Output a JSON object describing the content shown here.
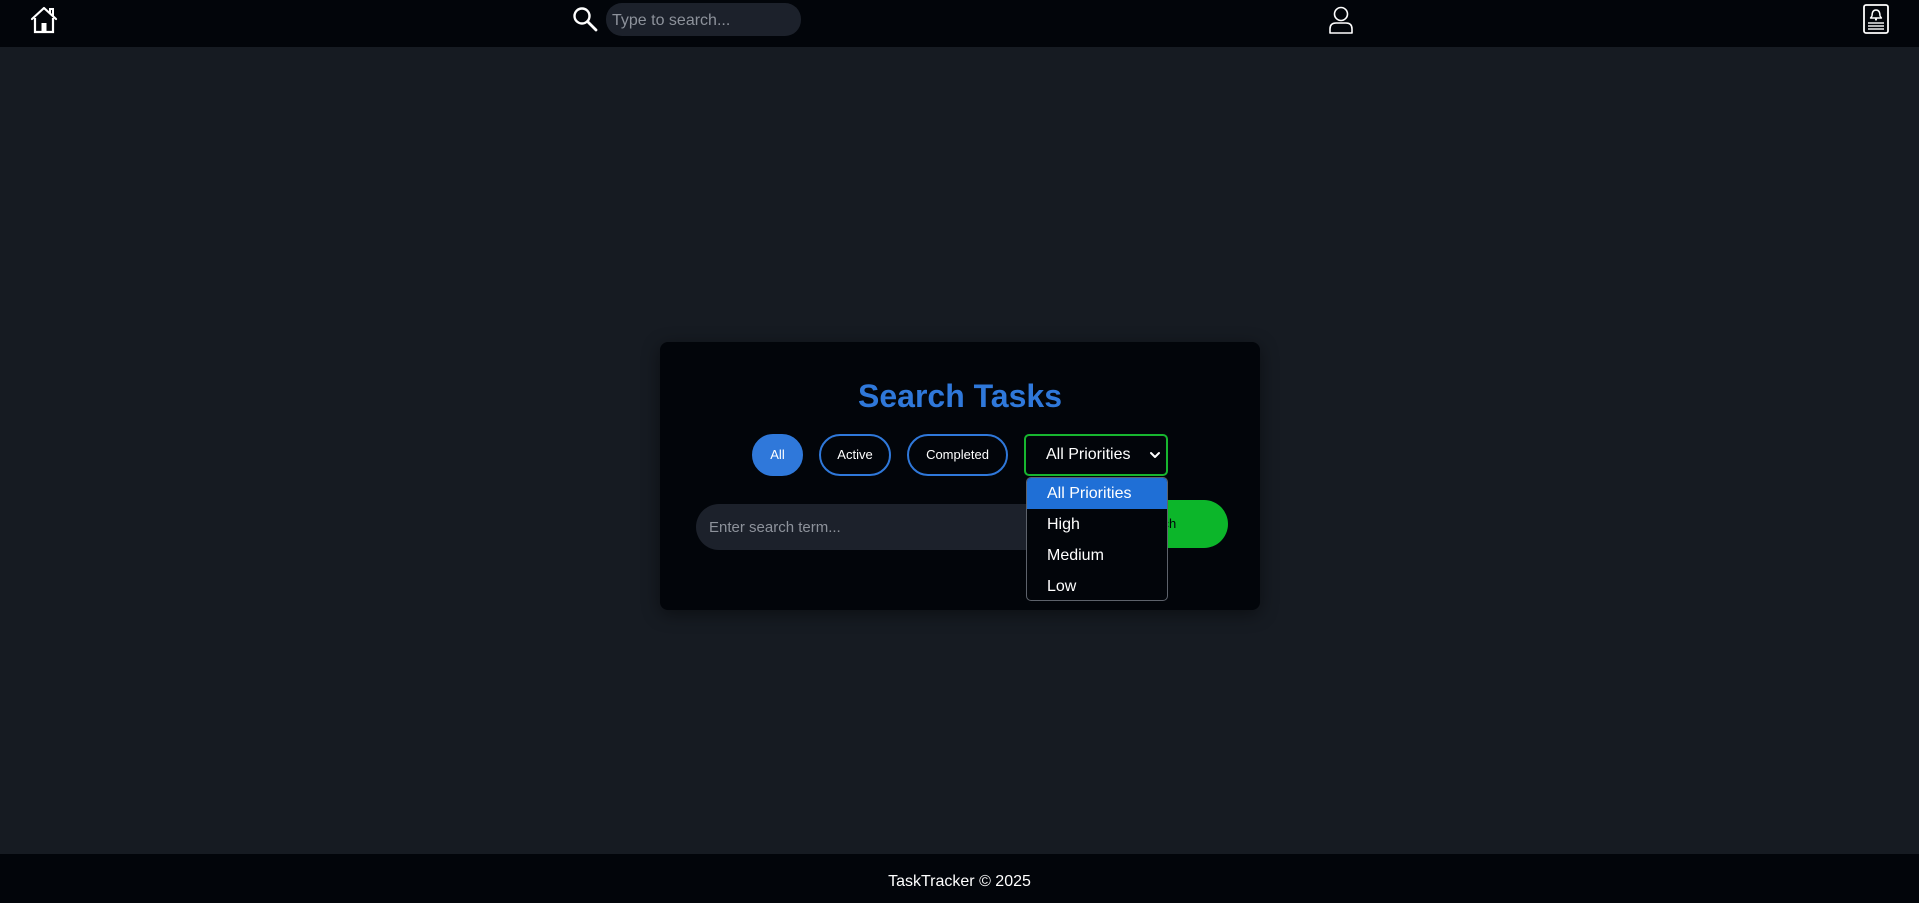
{
  "navbar": {
    "home_icon": "home-icon",
    "search_icon": "search-icon",
    "search_placeholder": "Type to search...",
    "user_icon": "user-icon",
    "notification_icon": "news-bell-icon"
  },
  "panel": {
    "title": "Search Tasks",
    "filters": [
      {
        "label": "All",
        "active": true
      },
      {
        "label": "Active",
        "active": false
      },
      {
        "label": "Completed",
        "active": false
      }
    ],
    "priority_select": {
      "selected": "All Priorities",
      "options": [
        "All Priorities",
        "High",
        "Medium",
        "Low"
      ]
    },
    "search_placeholder": "Enter search term...",
    "search_button": "Search"
  },
  "footer": {
    "text": "TaskTracker © 2025"
  },
  "colors": {
    "page_bg": "#161b22",
    "bar_bg": "#02050a",
    "accent_blue": "#2f78da",
    "accent_green": "#0cb62a",
    "select_border": "#17b62f"
  }
}
